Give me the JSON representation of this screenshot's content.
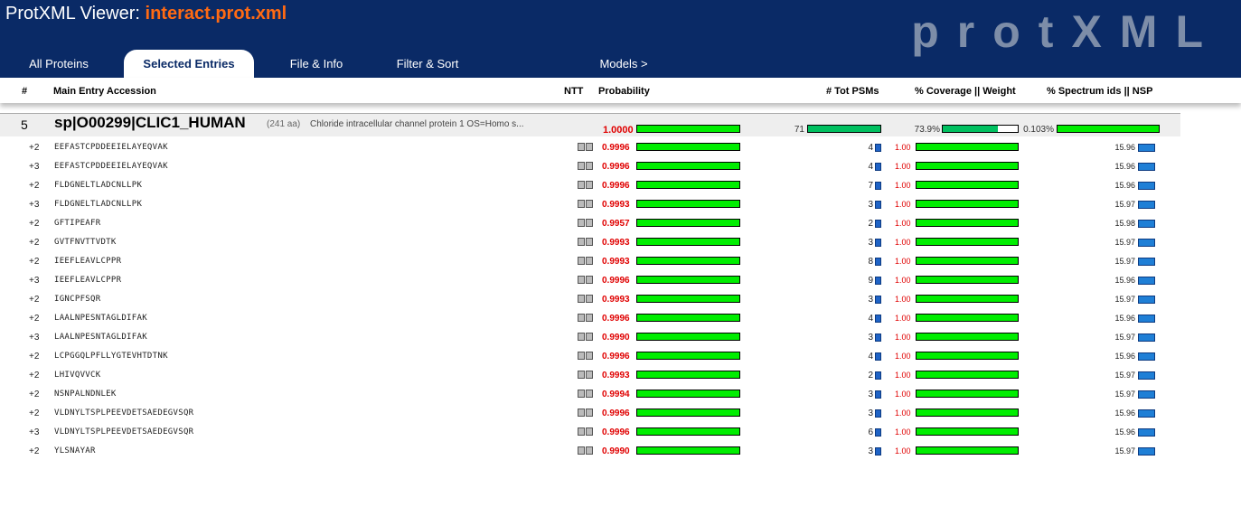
{
  "header": {
    "title_prefix": "ProtXML Viewer:",
    "file_name": "interact.prot.xml",
    "logo_text": "protXML"
  },
  "tabs": [
    {
      "label": "All Proteins",
      "active": false
    },
    {
      "label": "Selected Entries",
      "active": true
    },
    {
      "label": "File & Info",
      "active": false
    },
    {
      "label": "Filter & Sort",
      "active": false
    },
    {
      "label": "Models >",
      "active": false
    }
  ],
  "columns": {
    "index": "#",
    "accession": "Main Entry Accession",
    "ntt": "NTT",
    "probability": "Probability",
    "tot_psms": "# Tot PSMs",
    "coverage": "% Coverage || Weight",
    "spectrum": "% Spectrum ids || NSP"
  },
  "protein": {
    "index": "5",
    "accession": "sp|O00299|CLIC1_HUMAN",
    "length": "(241 aa)",
    "description": "Chloride intracellular channel protein 1 OS=Homo s...",
    "probability": "1.0000",
    "probability_fraction": 1.0,
    "tot_psms": "71",
    "coverage": "73.9%",
    "coverage_fraction": 0.739,
    "spectrum_ids": "0.103%"
  },
  "peptides": [
    {
      "charge": "+2",
      "sequence": "EEFASTCPDDEEIELAYEQVAK",
      "probability": "0.9996",
      "psms": "4",
      "weight": "1.00",
      "nsp": "15.96"
    },
    {
      "charge": "+3",
      "sequence": "EEFASTCPDDEEIELAYEQVAK",
      "probability": "0.9996",
      "psms": "4",
      "weight": "1.00",
      "nsp": "15.96"
    },
    {
      "charge": "+2",
      "sequence": "FLDGNELTLADCNLLPK",
      "probability": "0.9996",
      "psms": "7",
      "weight": "1.00",
      "nsp": "15.96"
    },
    {
      "charge": "+3",
      "sequence": "FLDGNELTLADCNLLPK",
      "probability": "0.9993",
      "psms": "3",
      "weight": "1.00",
      "nsp": "15.97"
    },
    {
      "charge": "+2",
      "sequence": "GFTIPEAFR",
      "probability": "0.9957",
      "psms": "2",
      "weight": "1.00",
      "nsp": "15.98"
    },
    {
      "charge": "+2",
      "sequence": "GVTFNVTTVDTK",
      "probability": "0.9993",
      "psms": "3",
      "weight": "1.00",
      "nsp": "15.97"
    },
    {
      "charge": "+2",
      "sequence": "IEEFLEAVLCPPR",
      "probability": "0.9993",
      "psms": "8",
      "weight": "1.00",
      "nsp": "15.97"
    },
    {
      "charge": "+3",
      "sequence": "IEEFLEAVLCPPR",
      "probability": "0.9996",
      "psms": "9",
      "weight": "1.00",
      "nsp": "15.96"
    },
    {
      "charge": "+2",
      "sequence": "IGNCPFSQR",
      "probability": "0.9993",
      "psms": "3",
      "weight": "1.00",
      "nsp": "15.97"
    },
    {
      "charge": "+2",
      "sequence": "LAALNPESNTAGLDIFAK",
      "probability": "0.9996",
      "psms": "4",
      "weight": "1.00",
      "nsp": "15.96"
    },
    {
      "charge": "+3",
      "sequence": "LAALNPESNTAGLDIFAK",
      "probability": "0.9990",
      "psms": "3",
      "weight": "1.00",
      "nsp": "15.97"
    },
    {
      "charge": "+2",
      "sequence": "LCPGGQLPFLLYGTEVHTDTNK",
      "probability": "0.9996",
      "psms": "4",
      "weight": "1.00",
      "nsp": "15.96"
    },
    {
      "charge": "+2",
      "sequence": "LHIVQVVCK",
      "probability": "0.9993",
      "psms": "2",
      "weight": "1.00",
      "nsp": "15.97"
    },
    {
      "charge": "+2",
      "sequence": "NSNPALNDNLEK",
      "probability": "0.9994",
      "psms": "3",
      "weight": "1.00",
      "nsp": "15.97"
    },
    {
      "charge": "+2",
      "sequence": "VLDNYLTSPLPEEVDETSAEDEGVSQR",
      "probability": "0.9996",
      "psms": "3",
      "weight": "1.00",
      "nsp": "15.96"
    },
    {
      "charge": "+3",
      "sequence": "VLDNYLTSPLPEEVDETSAEDEGVSQR",
      "probability": "0.9996",
      "psms": "6",
      "weight": "1.00",
      "nsp": "15.96"
    },
    {
      "charge": "+2",
      "sequence": "YLSNAYAR",
      "probability": "0.9990",
      "psms": "3",
      "weight": "1.00",
      "nsp": "15.97"
    }
  ],
  "colors": {
    "header_bg": "#0a2a66",
    "file_name": "#ff6a13",
    "probability_text": "#e00000",
    "bar_fill": "#00ee00",
    "psm_bar": "#1f63c6"
  }
}
